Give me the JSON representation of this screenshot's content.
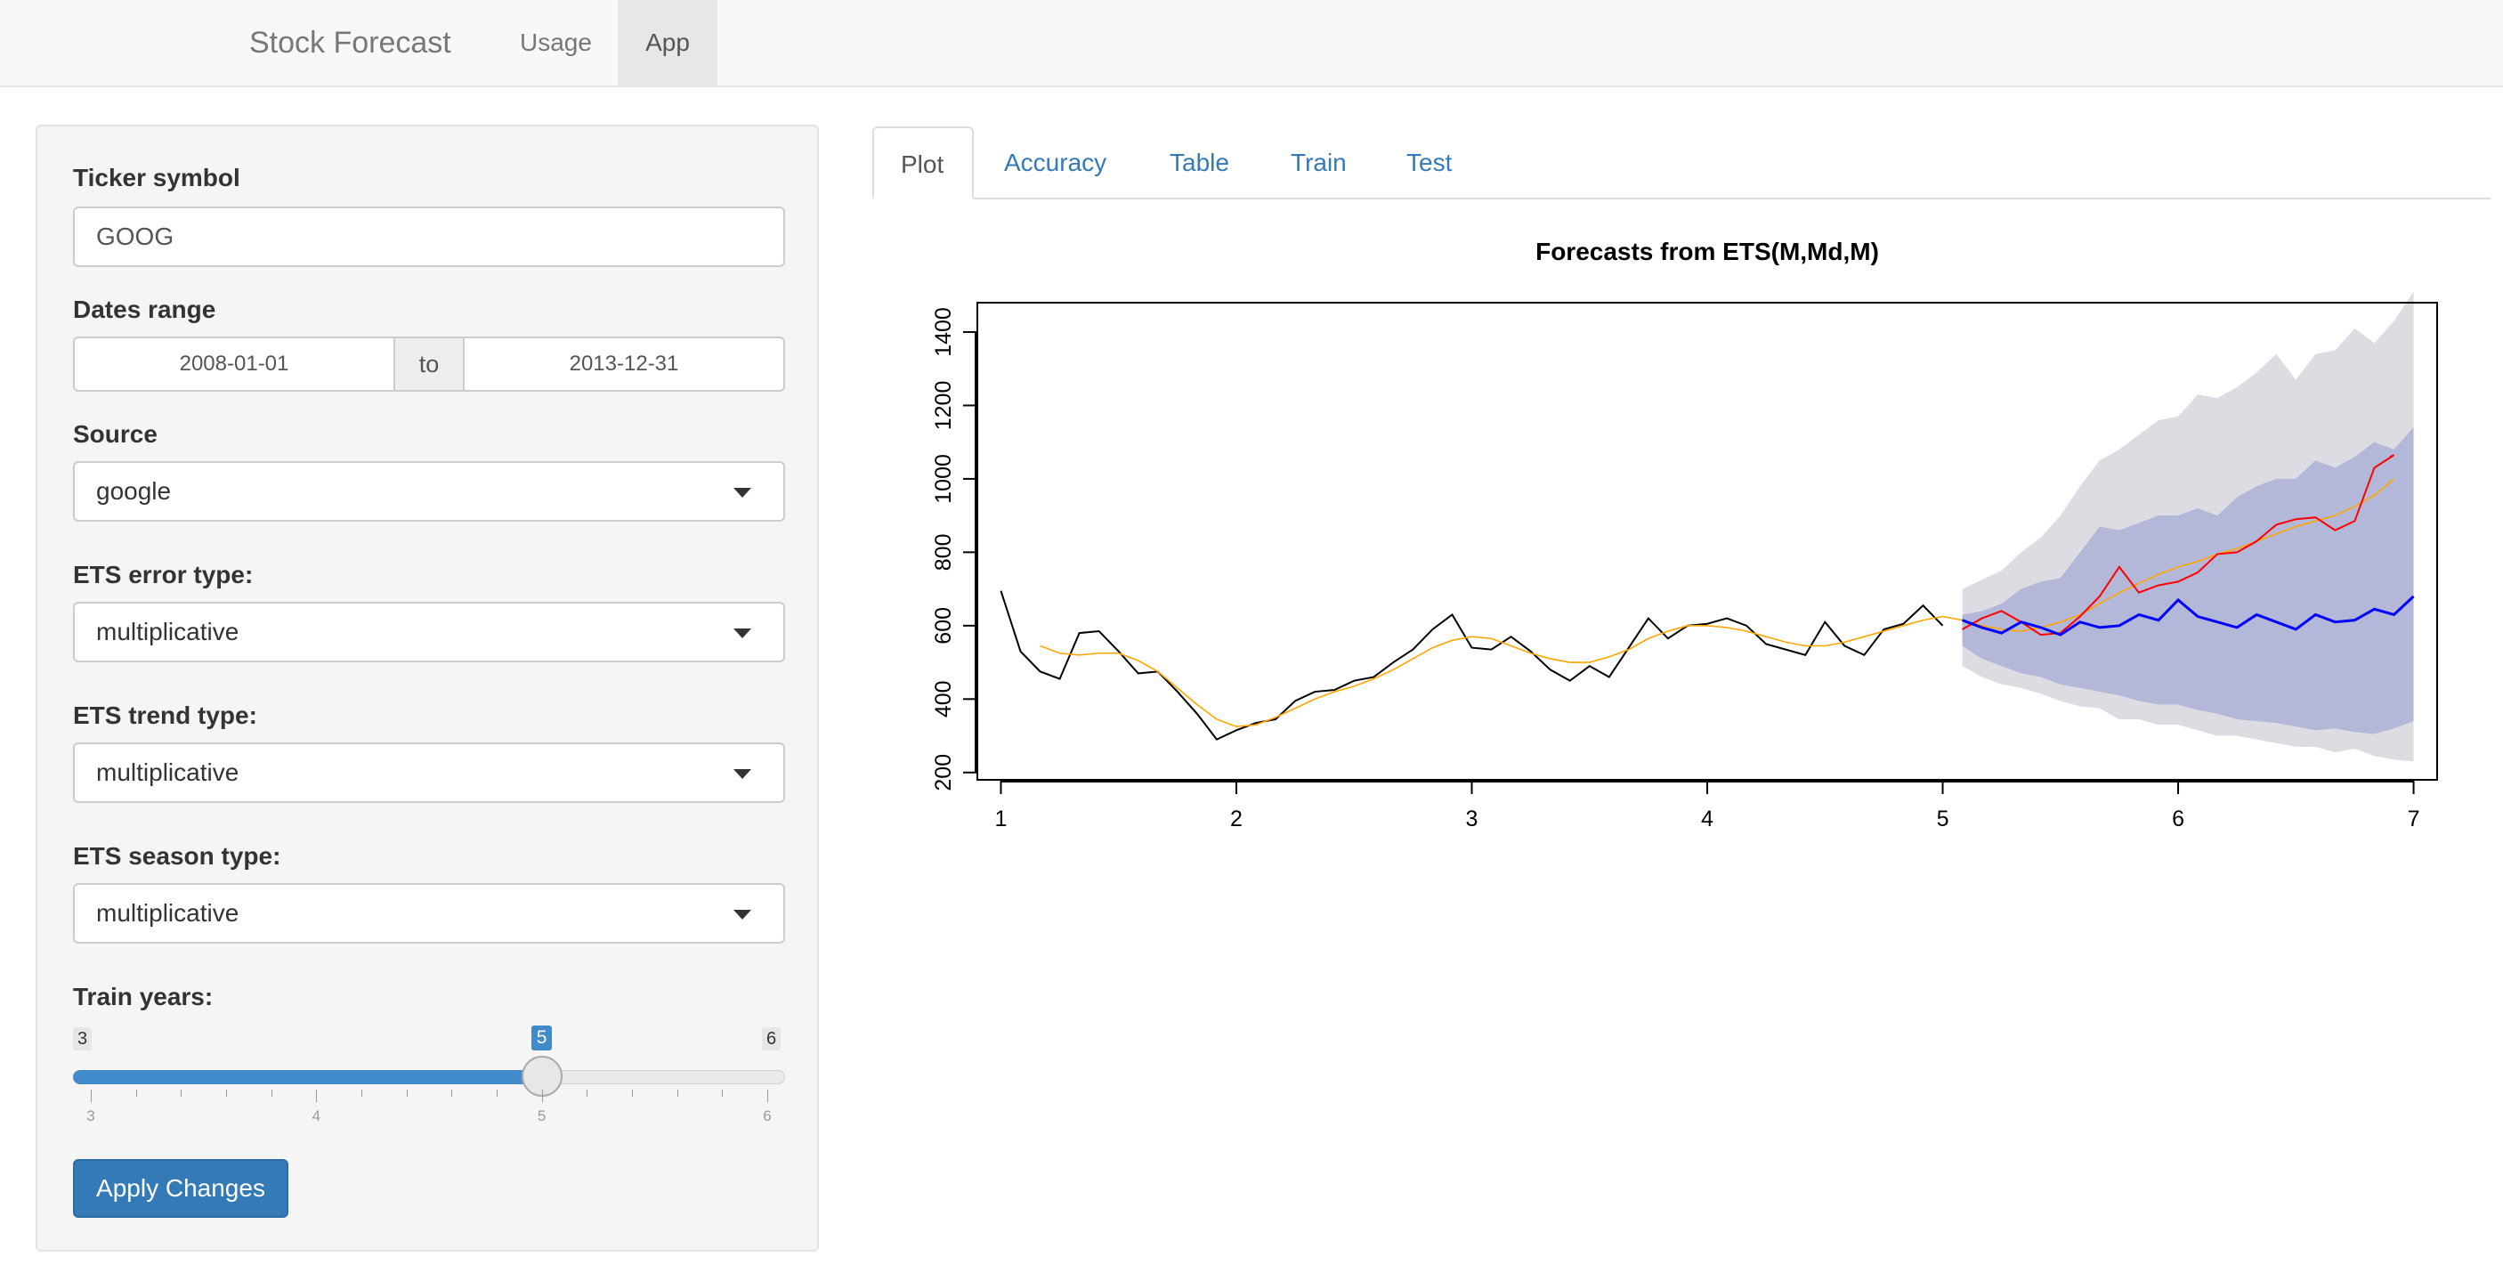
{
  "navbar": {
    "brand": "Stock Forecast",
    "items": [
      {
        "label": "Usage"
      },
      {
        "label": "App"
      }
    ]
  },
  "sidebar": {
    "ticker": {
      "label": "Ticker symbol",
      "value": "GOOG"
    },
    "dates": {
      "label": "Dates range",
      "start": "2008-01-01",
      "separator": "to",
      "end": "2013-12-31"
    },
    "source": {
      "label": "Source",
      "value": "google"
    },
    "ets_error": {
      "label": "ETS error type:",
      "value": "multiplicative"
    },
    "ets_trend": {
      "label": "ETS trend type:",
      "value": "multiplicative"
    },
    "ets_season": {
      "label": "ETS season type:",
      "value": "multiplicative"
    },
    "train_years": {
      "label": "Train years:",
      "min": "3",
      "max": "6",
      "value": "5",
      "value_fraction": 0.6667,
      "ticks": [
        "3",
        "4",
        "5",
        "6"
      ]
    },
    "apply_label": "Apply Changes"
  },
  "tabs": [
    {
      "label": "Plot"
    },
    {
      "label": "Accuracy"
    },
    {
      "label": "Table"
    },
    {
      "label": "Train"
    },
    {
      "label": "Test"
    }
  ],
  "colors": {
    "accent": "#337ab7",
    "fit": "#ffa500",
    "forecast": "#0000ff",
    "actual_test": "#ff0000",
    "band80": "#b4b8d8",
    "band95": "#dcdce2"
  },
  "chart_data": {
    "type": "line",
    "title": "Forecasts from ETS(M,Md,M)",
    "xlabel": "",
    "ylabel": "",
    "xlim": [
      0.9,
      7.1
    ],
    "ylim": [
      180,
      1480
    ],
    "xticks": [
      "1",
      "2",
      "3",
      "4",
      "5",
      "6",
      "7"
    ],
    "yticks": [
      "200",
      "400",
      "600",
      "800",
      "1000",
      "1200",
      "1400"
    ],
    "series": [
      {
        "x": [
          1,
          1.0833,
          1.1667,
          1.25,
          1.3333,
          1.4167,
          1.5,
          1.5833,
          1.6667,
          1.75,
          1.8333,
          1.9167,
          2,
          2.0833,
          2.1667,
          2.25,
          2.3333,
          2.4167,
          2.5,
          2.5833,
          2.6667,
          2.75,
          2.8333,
          2.9167,
          3,
          3.0833,
          3.1667,
          3.25,
          3.3333,
          3.4167,
          3.5,
          3.5833,
          3.6667,
          3.75,
          3.8333,
          3.9167,
          4,
          4.0833,
          4.1667,
          4.25,
          4.3333,
          4.4167,
          4.5,
          4.5833,
          4.6667,
          4.75,
          4.8333,
          4.9167,
          5
        ],
        "values": [
          695,
          530,
          475,
          455,
          580,
          585,
          530,
          470,
          475,
          420,
          360,
          290,
          315,
          335,
          345,
          395,
          420,
          425,
          450,
          460,
          500,
          535,
          590,
          630,
          540,
          535,
          570,
          530,
          480,
          450,
          490,
          460,
          540,
          620,
          565,
          600,
          605,
          620,
          600,
          550,
          535,
          520,
          610,
          545,
          520,
          590,
          605,
          655,
          600
        ]
      },
      {
        "x": [
          1.1667,
          1.25,
          1.3333,
          1.4167,
          1.5,
          1.5833,
          1.6667,
          1.75,
          1.8333,
          1.9167,
          2,
          2.0833,
          2.1667,
          2.25,
          2.3333,
          2.4167,
          2.5,
          2.5833,
          2.6667,
          2.75,
          2.8333,
          2.9167,
          3,
          3.0833,
          3.1667,
          3.25,
          3.3333,
          3.4167,
          3.5,
          3.5833,
          3.6667,
          3.75,
          3.8333,
          3.9167,
          4,
          4.0833,
          4.1667,
          4.25,
          4.3333,
          4.4167,
          4.5,
          4.5833,
          4.6667,
          4.75,
          4.8333,
          4.9167,
          5,
          5.0833,
          5.1667,
          5.25,
          5.3333,
          5.4167,
          5.5,
          5.5833,
          5.6667,
          5.75,
          5.8333,
          5.9167,
          6,
          6.0833,
          6.1667,
          6.25,
          6.3333,
          6.4167,
          6.5,
          6.5833,
          6.6667,
          6.75,
          6.8333,
          6.9167
        ],
        "values": [
          545,
          525,
          520,
          525,
          525,
          505,
          475,
          430,
          385,
          345,
          325,
          330,
          350,
          375,
          400,
          420,
          435,
          455,
          480,
          510,
          540,
          560,
          570,
          565,
          545,
          525,
          510,
          500,
          500,
          515,
          535,
          565,
          585,
          600,
          600,
          595,
          585,
          570,
          555,
          545,
          545,
          555,
          570,
          585,
          600,
          615,
          625,
          615,
          600,
          590,
          585,
          595,
          610,
          630,
          660,
          690,
          715,
          740,
          760,
          775,
          795,
          810,
          830,
          850,
          870,
          885,
          900,
          925,
          955,
          1000
        ]
      },
      {
        "x": [
          5.0833,
          5.1667,
          5.25,
          5.3333,
          5.4167,
          5.5,
          5.5833,
          5.6667,
          5.75,
          5.8333,
          5.9167,
          6,
          6.0833,
          6.1667,
          6.25,
          6.3333,
          6.4167,
          6.5,
          6.5833,
          6.6667,
          6.75,
          6.8333,
          6.9167,
          6.9
        ],
        "values": [
          590,
          620,
          640,
          610,
          575,
          580,
          625,
          680,
          760,
          690,
          710,
          720,
          745,
          795,
          800,
          830,
          875,
          890,
          895,
          860,
          885,
          1030,
          1065,
          1060
        ]
      },
      {
        "x": [
          5.0833,
          5.1667,
          5.25,
          5.3333,
          5.4167,
          5.5,
          5.5833,
          5.6667,
          5.75,
          5.8333,
          5.9167,
          6,
          6.0833,
          6.1667,
          6.25,
          6.3333,
          6.4167,
          6.5,
          6.5833,
          6.6667,
          6.75,
          6.8333,
          6.9167,
          7
        ],
        "values": [
          615,
          595,
          580,
          610,
          595,
          575,
          610,
          595,
          600,
          630,
          615,
          670,
          625,
          610,
          595,
          630,
          610,
          590,
          630,
          610,
          615,
          645,
          630,
          680
        ]
      }
    ],
    "bands": {
      "x": [
        5.0833,
        5.1667,
        5.25,
        5.3333,
        5.4167,
        5.5,
        5.5833,
        5.6667,
        5.75,
        5.8333,
        5.9167,
        6,
        6.0833,
        6.1667,
        6.25,
        6.3333,
        6.4167,
        6.5,
        6.5833,
        6.6667,
        6.75,
        6.8333,
        6.9167,
        7
      ],
      "hi80": [
        630,
        640,
        660,
        700,
        720,
        730,
        800,
        870,
        860,
        880,
        900,
        900,
        920,
        900,
        950,
        980,
        1000,
        1000,
        1050,
        1030,
        1060,
        1100,
        1080,
        1140
      ],
      "lo80": [
        545,
        510,
        490,
        470,
        460,
        440,
        430,
        420,
        410,
        395,
        385,
        385,
        370,
        360,
        345,
        340,
        335,
        325,
        315,
        320,
        310,
        305,
        320,
        340
      ],
      "hi95": [
        700,
        725,
        750,
        800,
        840,
        900,
        980,
        1050,
        1080,
        1120,
        1160,
        1170,
        1230,
        1220,
        1250,
        1290,
        1340,
        1270,
        1340,
        1350,
        1410,
        1370,
        1430,
        1510
      ],
      "lo95": [
        490,
        460,
        440,
        430,
        415,
        395,
        380,
        375,
        345,
        345,
        330,
        330,
        315,
        300,
        300,
        290,
        280,
        270,
        270,
        255,
        265,
        245,
        235,
        230
      ]
    }
  }
}
